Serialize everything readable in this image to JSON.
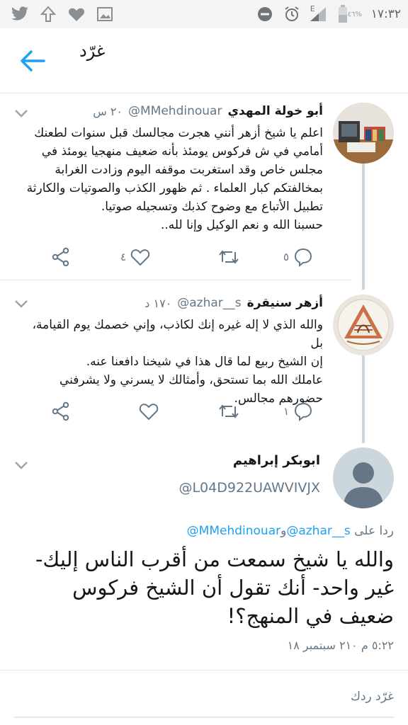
{
  "status_bar": {
    "time": "١٧:٣٢",
    "battery": "٤٦%",
    "signal_label": "E",
    "left_icons": [
      "twitter-icon",
      "upload-icon",
      "heart-icon",
      "image-icon"
    ],
    "right_icons": [
      "do-not-disturb-icon",
      "alarm-icon",
      "signal-icon",
      "battery-icon"
    ]
  },
  "app_bar": {
    "title": "غرّد",
    "back_icon": "arrow-back-icon",
    "accent_color": "#1da1f2"
  },
  "tweets": [
    {
      "name": "أبو خولة المهدي",
      "handle": "@MMehdinouar",
      "time": "٢٠ س",
      "lines": [
        "اعلم يا شيخ أزهر أنني هجرت مجالسك قبل سنوات لطعنك",
        "أمامي في ش فركوس يومئذ بأنه ضعيف منهجيا يومئذ في",
        "مجلس خاص وقد استغربت موقفه اليوم وزادت الغرابة",
        "بمخالفتكم كبار العلماء . ثم ظهور الكذب والصوتيات والكارثة",
        "تطبيل الأتباع مع وضوح كذبك وتسجيله صوتيا.",
        "حسبنا الله و نعم الوكيل وإنا لله.."
      ],
      "replies": "٥",
      "likes": "٤"
    },
    {
      "name": "أزهر سنيقرة",
      "handle": "@azhar__s",
      "time": "١٧٠ د",
      "lines": [
        "والله الذي لا إله غيره إنك لكاذب، وإني خصمك يوم القيامة، بل",
        "إن الشيخ ربيع لما قال هذا في شيخنا دافعنا عنه.",
        "عاملك الله بما تستحق، وأمثالك لا يسرني ولا يشرفني",
        "حضورهم مجالس."
      ],
      "replies": "١",
      "likes": ""
    }
  ],
  "focused_tweet": {
    "name": "ابوبكر إبراهيم",
    "handle": "@L04D922UAWVIVJX",
    "reply_prefix": "ردا على",
    "reply_mention_1": "@azhar__s",
    "reply_joiner": "و",
    "reply_mention_2": "@MMehdinouar",
    "text": "والله يا شيخ سمعت من أقرب الناس إليك- غير واحد- أنك تقول أن الشيخ فركوس ضعيف في المنهج؟!",
    "date": "٥:٢٢ م ٢١٠ سبتمبر ١٨"
  },
  "reply_box": {
    "placeholder": "غرّد ردك"
  }
}
